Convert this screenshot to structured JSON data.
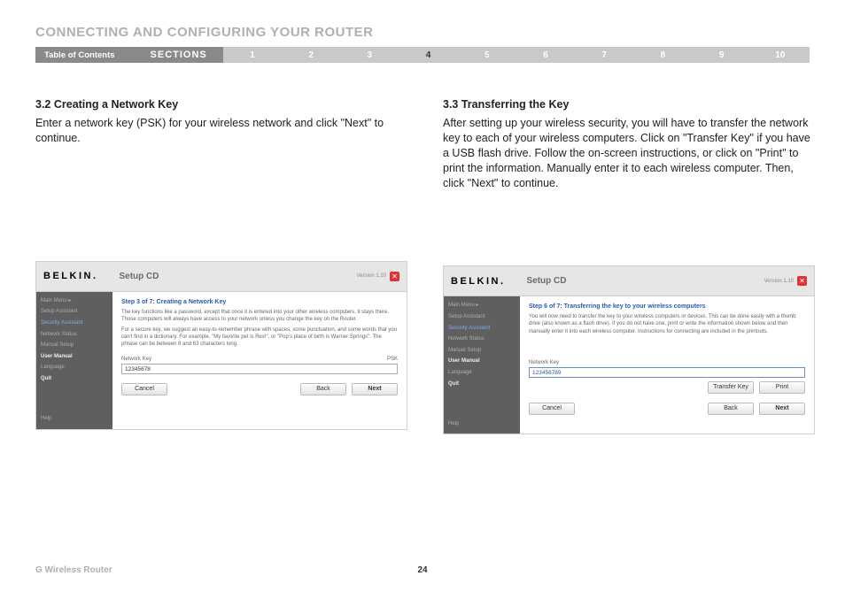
{
  "page_title": "CONNECTING AND CONFIGURING YOUR ROUTER",
  "nav": {
    "toc": "Table of Contents",
    "sections": "SECTIONS",
    "nums": [
      "1",
      "2",
      "3",
      "4",
      "5",
      "6",
      "7",
      "8",
      "9",
      "10"
    ],
    "active_index": 3
  },
  "left": {
    "heading": "3.2 Creating a Network Key",
    "body": "Enter a network key (PSK) for your wireless network and click \"Next\" to continue.",
    "shot": {
      "brand": "BELKIN.",
      "app": "Setup CD",
      "version": "Version 1.10",
      "side": {
        "items": [
          {
            "label": "Main Menu  ▸",
            "cls": ""
          },
          {
            "label": "Setup Assistant",
            "cls": ""
          },
          {
            "label": "Security Assistant",
            "cls": "sel"
          },
          {
            "label": "Network Status",
            "cls": ""
          },
          {
            "label": "Manual Setup",
            "cls": ""
          },
          {
            "label": "User Manual",
            "cls": "wht"
          },
          {
            "label": "Language",
            "cls": ""
          },
          {
            "label": "Quit",
            "cls": "wht"
          }
        ],
        "help": "Help"
      },
      "step": "Step 3 of 7: Creating a Network Key",
      "para1": "The key functions like a password, except that once it is entered into your other wireless computers, it stays there. Those computers will always have access to your network unless you change the key on the Router.",
      "para2": "For a secure key, we suggest an easy-to-remember phrase with spaces, some punctuation, and some words that you can't find in a dictionary. For example, \"My favorite pet is Rex!\", or \"Pop's place of birth is Warner Springs\". The phrase can be between 8 and 63 characters long.",
      "field_label_left": "Network Key",
      "field_label_right": "PSK",
      "field_value": "12345678",
      "cancel": "Cancel",
      "back": "Back",
      "next": "Next"
    }
  },
  "right": {
    "heading": "3.3 Transferring the Key",
    "body": "After setting up your wireless security, you will have to transfer the network key to each of your wireless computers. Click on \"Transfer Key\" if you have a USB flash drive. Follow the on-screen instructions, or click on \"Print\" to print the information. Manually enter it to each wireless computer. Then, click \"Next\" to continue.",
    "shot": {
      "brand": "BELKIN.",
      "app": "Setup CD",
      "version": "Version 1.10",
      "side": {
        "items": [
          {
            "label": "Main Menu  ▸",
            "cls": ""
          },
          {
            "label": "Setup Assistant",
            "cls": ""
          },
          {
            "label": "Security Assistant",
            "cls": "sel"
          },
          {
            "label": "Network Status",
            "cls": ""
          },
          {
            "label": "Manual Setup",
            "cls": ""
          },
          {
            "label": "User Manual",
            "cls": "wht"
          },
          {
            "label": "Language",
            "cls": ""
          },
          {
            "label": "Quit",
            "cls": "wht"
          }
        ],
        "help": "Help"
      },
      "step": "Step 6 of 7: Transferring the key to your wireless computers",
      "para1": "You will now need to transfer the key to your wireless computers or devices. This can be done easily with a thumb drive (also known as a flash drive). If you do not have one, print or write the information shown below and then manually enter it into each wireless computer. Instructions for connecting are included in the printouts.",
      "field_label_left": "Network Key",
      "field_value": "123456789",
      "transfer": "Transfer Key",
      "print": "Print",
      "cancel": "Cancel",
      "back": "Back",
      "next": "Next"
    }
  },
  "footer": {
    "left": "G Wireless Router",
    "page": "24"
  }
}
